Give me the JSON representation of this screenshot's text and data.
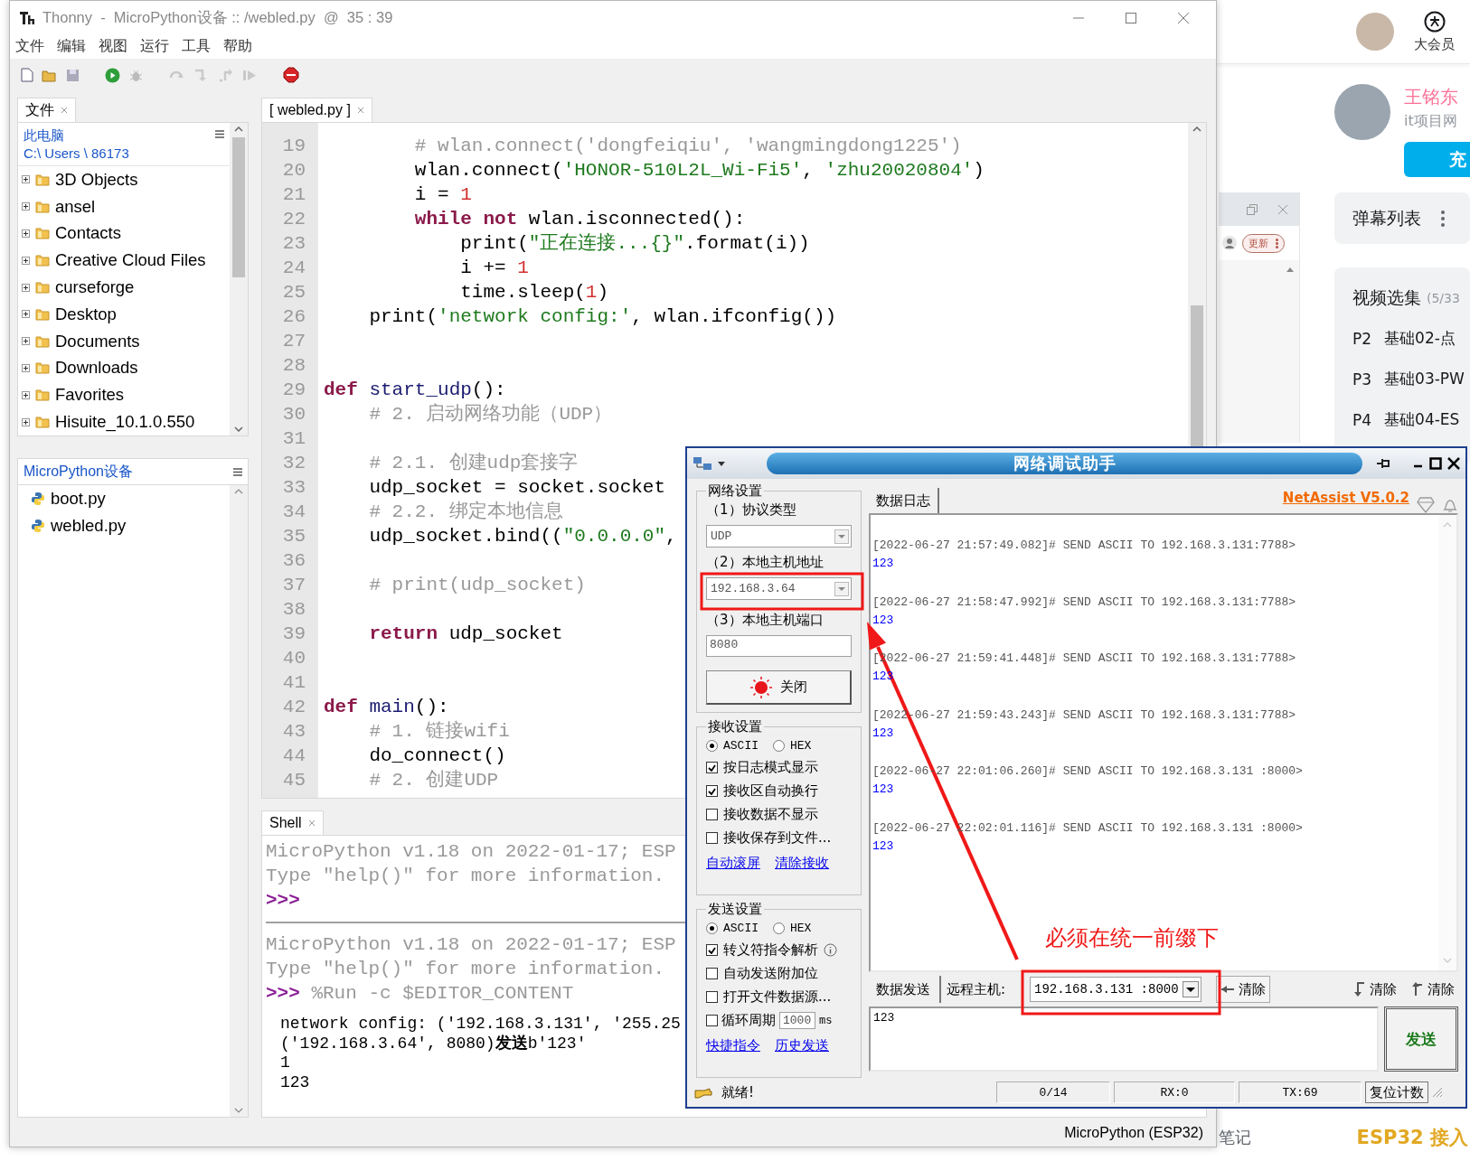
{
  "thonny": {
    "title": "Thonny  -  MicroPython设备 :: /webled.py  @  35 : 39",
    "menu": [
      "文件",
      "编辑",
      "视图",
      "运行",
      "工具",
      "帮助"
    ],
    "files_panel": {
      "tab": "文件",
      "location": "此电脑",
      "path": "C:\\ Users \\ 86173",
      "items": [
        "3D Objects",
        "ansel",
        "Contacts",
        "Creative Cloud Files",
        "curseforge",
        "Desktop",
        "Documents",
        "Downloads",
        "Favorites",
        "Hisuite_10.1.0.550"
      ]
    },
    "device_panel": {
      "title": "MicroPython设备",
      "items": [
        "boot.py",
        "webled.py"
      ]
    },
    "editor": {
      "tab": "[ webled.py ]",
      "lines": [
        {
          "number": "19",
          "tokens": [
            {
              "kind": "comment",
              "text": "        # wlan.connect('dongfeiqiu', 'wangmingdong1225')"
            }
          ]
        },
        {
          "number": "20",
          "tokens": [
            {
              "kind": "plain",
              "text": "        wlan.connect("
            },
            {
              "kind": "string",
              "text": "'HONOR-510L2L_Wi-Fi5'"
            },
            {
              "kind": "plain",
              "text": ", "
            },
            {
              "kind": "string",
              "text": "'zhu20020804'"
            },
            {
              "kind": "plain",
              "text": ")"
            }
          ]
        },
        {
          "number": "21",
          "tokens": [
            {
              "kind": "plain",
              "text": "        i = "
            },
            {
              "kind": "number",
              "text": "1"
            }
          ]
        },
        {
          "number": "22",
          "tokens": [
            {
              "kind": "keyword",
              "text": "        while"
            },
            {
              "kind": "keyword",
              "text": " not"
            },
            {
              "kind": "plain",
              "text": " wlan.isconnected():"
            }
          ]
        },
        {
          "number": "23",
          "tokens": [
            {
              "kind": "plain",
              "text": "            print("
            },
            {
              "kind": "string",
              "text": "\"正在连接...{}\""
            },
            {
              "kind": "plain",
              "text": ".format(i))"
            }
          ]
        },
        {
          "number": "24",
          "tokens": [
            {
              "kind": "plain",
              "text": "            i += "
            },
            {
              "kind": "number",
              "text": "1"
            }
          ]
        },
        {
          "number": "25",
          "tokens": [
            {
              "kind": "plain",
              "text": "            time.sleep("
            },
            {
              "kind": "number",
              "text": "1"
            },
            {
              "kind": "plain",
              "text": ")"
            }
          ]
        },
        {
          "number": "26",
          "tokens": [
            {
              "kind": "plain",
              "text": "    print("
            },
            {
              "kind": "string",
              "text": "'network config:'"
            },
            {
              "kind": "plain",
              "text": ", wlan.ifconfig())"
            }
          ]
        },
        {
          "number": "27"
        },
        {
          "number": "28"
        },
        {
          "number": "29",
          "tokens": [
            {
              "kind": "keyword",
              "text": "def"
            },
            {
              "kind": "function",
              "text": " start_udp"
            },
            {
              "kind": "plain",
              "text": "():"
            }
          ]
        },
        {
          "number": "30",
          "tokens": [
            {
              "kind": "comment",
              "text": "    # 2. 启动网络功能（UDP）"
            }
          ]
        },
        {
          "number": "31"
        },
        {
          "number": "32",
          "tokens": [
            {
              "kind": "comment",
              "text": "    # 2.1. 创建udp套接字"
            }
          ]
        },
        {
          "number": "33",
          "tokens": [
            {
              "kind": "plain",
              "text": "    udp_socket = socket.socket"
            }
          ]
        },
        {
          "number": "34",
          "tokens": [
            {
              "kind": "comment",
              "text": "    # 2.2. 绑定本地信息"
            }
          ]
        },
        {
          "number": "35",
          "tokens": [
            {
              "kind": "plain",
              "text": "    udp_socket.bind(("
            },
            {
              "kind": "string",
              "text": "\"0.0.0.0\""
            },
            {
              "kind": "plain",
              "text": ","
            }
          ]
        },
        {
          "number": "36"
        },
        {
          "number": "37",
          "tokens": [
            {
              "kind": "comment",
              "text": "    # print(udp_socket)"
            }
          ]
        },
        {
          "number": "38"
        },
        {
          "number": "39",
          "tokens": [
            {
              "kind": "keyword",
              "text": "    return"
            },
            {
              "kind": "plain",
              "text": " udp_socket"
            }
          ]
        },
        {
          "number": "40"
        },
        {
          "number": "41"
        },
        {
          "number": "42",
          "tokens": [
            {
              "kind": "keyword",
              "text": "def"
            },
            {
              "kind": "function",
              "text": " main"
            },
            {
              "kind": "plain",
              "text": "():"
            }
          ]
        },
        {
          "number": "43",
          "tokens": [
            {
              "kind": "comment",
              "text": "    # 1. 链接wifi"
            }
          ]
        },
        {
          "number": "44",
          "tokens": [
            {
              "kind": "plain",
              "text": "    do_connect()"
            }
          ]
        },
        {
          "number": "45",
          "tokens": [
            {
              "kind": "comment",
              "text": "    # 2. 创建UDP"
            }
          ]
        }
      ]
    },
    "shell": {
      "tab": "Shell",
      "lines": [
        {
          "kind": "banner",
          "text": "MicroPython v1.18 on 2022-01-17; ESP"
        },
        {
          "kind": "banner",
          "text": "Type \"help()\" for more information."
        },
        {
          "kind": "prompt",
          "prompt": ">>>"
        },
        {
          "kind": "divider"
        },
        {
          "kind": "banner",
          "text": "MicroPython v1.18 on 2022-01-17; ESP"
        },
        {
          "kind": "banner",
          "text": "Type \"help()\" for more information."
        },
        {
          "kind": "prompt",
          "prompt": ">>>",
          "command": "%Run -c $EDITOR_CONTENT"
        },
        {
          "kind": "output",
          "text": "network config: ('192.168.3.131', '255.25"
        },
        {
          "kind": "output",
          "text": "('192.168.3.64', 8080)**发送**b'123'"
        },
        {
          "kind": "output",
          "text": "1"
        },
        {
          "kind": "output",
          "text": "123"
        }
      ]
    },
    "status": "MicroPython (ESP32)"
  },
  "netassist": {
    "title": "网络调试助手",
    "network_settings": {
      "title": "网络设置",
      "protocol_label": "（1）协议类型",
      "protocol": "UDP",
      "host_label": "（2）本地主机地址",
      "host": "192.168.3.64",
      "port_label": "（3）本地主机端口",
      "port": "8080",
      "toggle_button": "关闭"
    },
    "receive_settings": {
      "title": "接收设置",
      "encodings": [
        {
          "label": "ASCII",
          "selected": true
        },
        {
          "label": "HEX",
          "selected": false
        }
      ],
      "options": [
        {
          "label": "按日志模式显示",
          "checked": true
        },
        {
          "label": "接收区自动换行",
          "checked": true
        },
        {
          "label": "接收数据不显示",
          "checked": false
        },
        {
          "label": "接收保存到文件...",
          "checked": false
        }
      ],
      "links": [
        "自动滚屏",
        "清除接收"
      ]
    },
    "send_settings": {
      "title": "发送设置",
      "encodings": [
        {
          "label": "ASCII",
          "selected": true
        },
        {
          "label": "HEX",
          "selected": false
        }
      ],
      "options": [
        {
          "label": "转义符指令解析",
          "checked": true,
          "info": true
        },
        {
          "label": "自动发送附加位",
          "checked": false
        },
        {
          "label": "打开文件数据源...",
          "checked": false
        },
        {
          "label": "循环周期",
          "checked": false,
          "period": "1000",
          "unit": "ms"
        }
      ],
      "links": [
        "快捷指令",
        "历史发送"
      ]
    },
    "log_tab": "数据日志",
    "version_link": "NetAssist V5.0.2",
    "log": [
      {
        "header": "[2022-06-27 21:57:49.082]# SEND ASCII TO 192.168.3.131:7788>",
        "data": "123"
      },
      {
        "header": "[2022-06-27 21:58:47.992]# SEND ASCII TO 192.168.3.131:7788>",
        "data": "123"
      },
      {
        "header": "[2022-06-27 21:59:41.448]# SEND ASCII TO 192.168.3.131:7788>",
        "data": "123"
      },
      {
        "header": "[2022-06-27 21:59:43.243]# SEND ASCII TO 192.168.3.131:7788>",
        "data": "123"
      },
      {
        "header": "[2022-06-27 22:01:06.260]# SEND ASCII TO 192.168.3.131 :8000>",
        "data": "123"
      },
      {
        "header": "[2022-06-27 22:02:01.116]# SEND ASCII TO 192.168.3.131 :8000>",
        "data": "123"
      }
    ],
    "send_tab": "数据发送",
    "remote_label": "远程主机:",
    "remote": "192.168.3.131 :8000",
    "clear_buttons": [
      {
        "kind": "left",
        "label": "清除"
      },
      {
        "kind": "down",
        "label": "清除"
      },
      {
        "kind": "up",
        "label": "清除"
      }
    ],
    "send_text": "123",
    "send_button": "发送",
    "status": {
      "message": "就绪!",
      "counters": [
        "0/14",
        "RX:0",
        "TX:69"
      ],
      "reset_button": "复位计数"
    }
  },
  "annotation": {
    "note": "必须在统一前缀下"
  },
  "browser": {
    "vip_label": "大会员",
    "uploader": {
      "name": "王铭东",
      "bio": "it项目网",
      "charge_button": "充"
    },
    "mini_player": {
      "refresh_button": "更新"
    },
    "danmaku_title": "弹幕列表",
    "playlist": {
      "title": "视频选集",
      "count": "(5/33",
      "items": [
        {
          "part": "P2",
          "title": "基础02-点"
        },
        {
          "part": "P3",
          "title": "基础03-PW"
        },
        {
          "part": "P4",
          "title": "基础04-ES"
        }
      ]
    },
    "footer": {
      "notes": "笔记",
      "banner": "ESP32 接入"
    }
  }
}
